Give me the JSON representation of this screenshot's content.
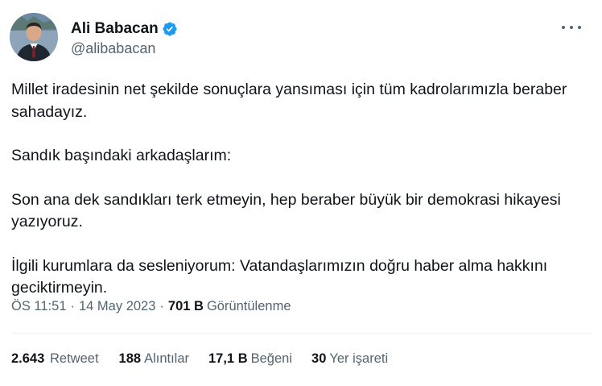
{
  "author": {
    "name": "Ali Babacan",
    "handle": "@alibabacan"
  },
  "tweet": {
    "paragraphs": [
      "Millet iradesinin net şekilde sonuçlara yansıması için tüm kadrolarımızla beraber sahadayız.",
      "Sandık başındaki arkadaşlarım:",
      "Son ana dek sandıkları terk etmeyin, hep beraber büyük bir demokrasi hikayesi yazıyoruz.",
      "İlgili kurumlara da sesleniyorum: Vatandaşlarımızın doğru haber alma hakkını geciktirmeyin."
    ]
  },
  "meta": {
    "time": "ÖS 11:51",
    "separator": "·",
    "date": "14 May 2023",
    "views_count": "701 B",
    "views_label": "Görüntülenme"
  },
  "stats": {
    "retweets": {
      "count": "2.643",
      "label": "Retweet"
    },
    "quotes": {
      "count": "188",
      "label": "Alıntılar"
    },
    "likes": {
      "count": "17,1 B",
      "label": "Beğeni"
    },
    "bookmarks": {
      "count": "30",
      "label": "Yer işareti"
    }
  },
  "icons": {
    "verified": "verified-badge-icon",
    "more": "more-options-icon"
  },
  "colors": {
    "primary_text": "#0f1419",
    "secondary_text": "#536471",
    "verified": "#1d9bf0",
    "divider": "#eff3f4"
  }
}
